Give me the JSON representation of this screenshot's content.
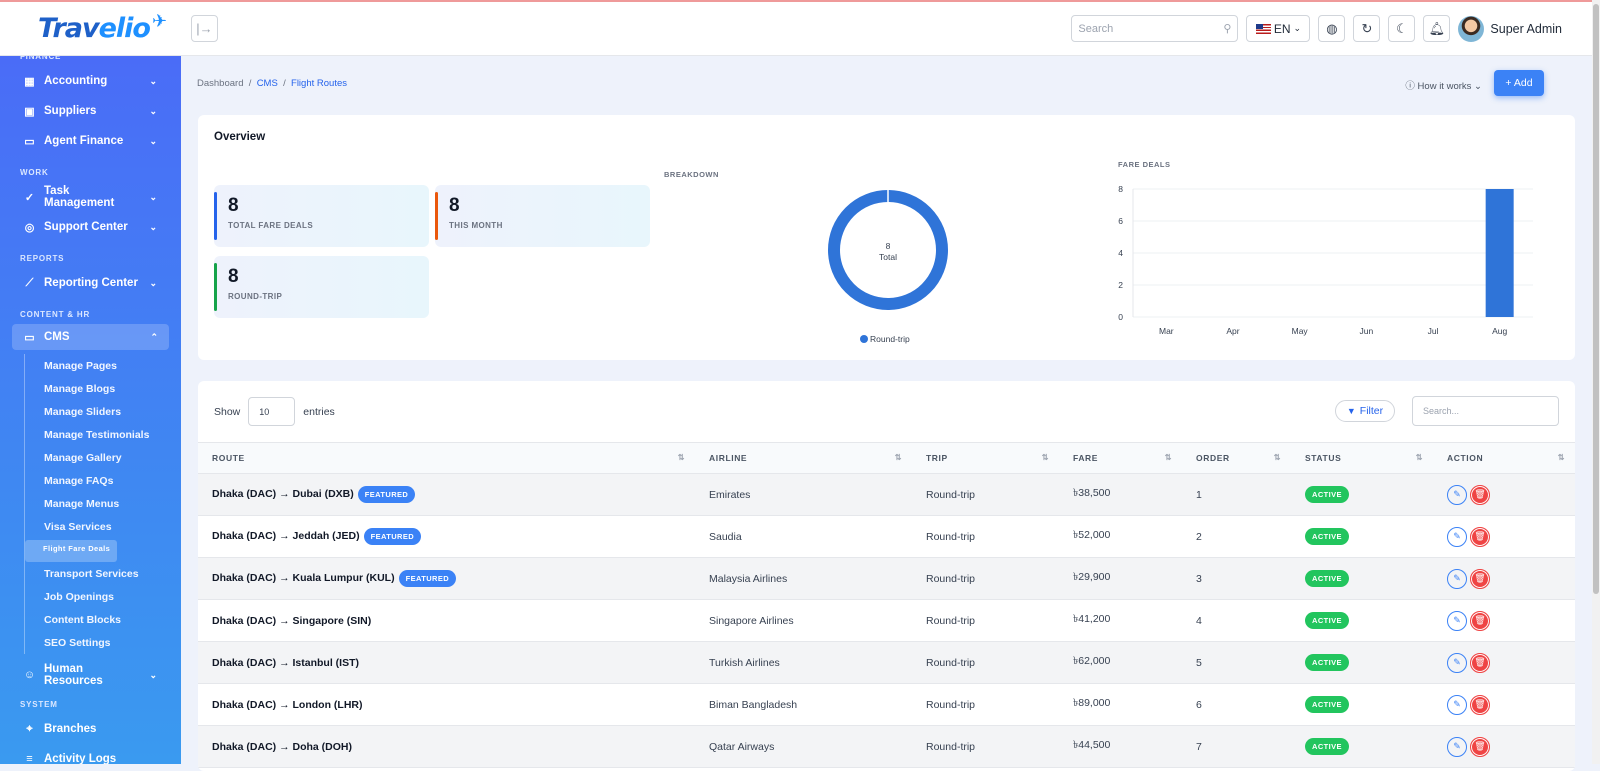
{
  "brand": {
    "part1": "Trav",
    "part2": "elio"
  },
  "header": {
    "search_placeholder": "Search",
    "language": "EN",
    "user_name": "Super Admin"
  },
  "sidebar": {
    "top_section": "FINANCE",
    "finance": [
      "Accounting",
      "Suppliers",
      "Agent Finance"
    ],
    "work_section": "WORK",
    "work": [
      "Task Management",
      "Support Center"
    ],
    "reports_section": "REPORTS",
    "reports": [
      "Reporting Center"
    ],
    "content_section": "CONTENT & HR",
    "cms_label": "CMS",
    "cms_items": [
      "Manage Pages",
      "Manage Blogs",
      "Manage Sliders",
      "Manage Testimonials",
      "Manage Gallery",
      "Manage FAQs",
      "Manage Menus",
      "Visa Services",
      "Flight Fare Deals",
      "Transport Services",
      "Job Openings",
      "Content Blocks",
      "SEO Settings"
    ],
    "active_item": "Flight Fare Deals",
    "hr_label": "Human Resources",
    "system_section": "SYSTEM",
    "branches_label": "Branches",
    "cut_label": "Activity Logs"
  },
  "breadcrumb": {
    "home": "Dashboard",
    "section": "CMS",
    "current": "Flight Routes"
  },
  "actions": {
    "how_it_works": "How it works",
    "add": "+ Add"
  },
  "overview": {
    "title": "Overview",
    "stats": [
      {
        "value": "8",
        "label": "TOTAL FARE DEALS",
        "color": "#2563eb"
      },
      {
        "value": "8",
        "label": "THIS MONTH",
        "color": "#ea580c"
      },
      {
        "value": "8",
        "label": "ROUND-TRIP",
        "color": "#16a34a"
      }
    ],
    "breakdown_caption": "BREAKDOWN",
    "fare_deals_caption": "FARE DEALS"
  },
  "chart_data": [
    {
      "type": "pie",
      "title": "BREAKDOWN",
      "categories": [
        "Round-trip"
      ],
      "values": [
        8
      ],
      "center_value": "8",
      "center_label": "Total",
      "legend_position": "bottom",
      "colors": [
        "#2f74d8"
      ]
    },
    {
      "type": "bar",
      "title": "FARE DEALS",
      "categories": [
        "Mar",
        "Apr",
        "May",
        "Jun",
        "Jul",
        "Aug"
      ],
      "values": [
        0,
        0,
        0,
        0,
        0,
        8
      ],
      "ylim": [
        0,
        8
      ],
      "yticks": [
        0,
        2,
        4,
        6,
        8
      ],
      "grid": true,
      "colors": [
        "#2f74d8"
      ]
    }
  ],
  "table": {
    "show_label": "Show",
    "entries_value": "10",
    "entries_label": "entries",
    "filter_label": "Filter",
    "search_placeholder": "Search...",
    "columns": [
      "ROUTE",
      "AIRLINE",
      "TRIP",
      "FARE",
      "ORDER",
      "STATUS",
      "ACTION"
    ],
    "rows": [
      {
        "route": "Dhaka (DAC) → Dubai (DXB)",
        "featured": "FEATURED",
        "airline": "Emirates",
        "trip": "Round-trip",
        "fare": "৳38,500",
        "order": "1",
        "status": "ACTIVE"
      },
      {
        "route": "Dhaka (DAC) → Jeddah (JED)",
        "featured": "FEATURED",
        "airline": "Saudia",
        "trip": "Round-trip",
        "fare": "৳52,000",
        "order": "2",
        "status": "ACTIVE"
      },
      {
        "route": "Dhaka (DAC) → Kuala Lumpur (KUL)",
        "featured": "FEATURED",
        "airline": "Malaysia Airlines",
        "trip": "Round-trip",
        "fare": "৳29,900",
        "order": "3",
        "status": "ACTIVE"
      },
      {
        "route": "Dhaka (DAC) → Singapore (SIN)",
        "featured": "",
        "airline": "Singapore Airlines",
        "trip": "Round-trip",
        "fare": "৳41,200",
        "order": "4",
        "status": "ACTIVE"
      },
      {
        "route": "Dhaka (DAC) → Istanbul (IST)",
        "featured": "",
        "airline": "Turkish Airlines",
        "trip": "Round-trip",
        "fare": "৳62,000",
        "order": "5",
        "status": "ACTIVE"
      },
      {
        "route": "Dhaka (DAC) → London (LHR)",
        "featured": "",
        "airline": "Biman Bangladesh",
        "trip": "Round-trip",
        "fare": "৳89,000",
        "order": "6",
        "status": "ACTIVE"
      },
      {
        "route": "Dhaka (DAC) → Doha (DOH)",
        "featured": "",
        "airline": "Qatar Airways",
        "trip": "Round-trip",
        "fare": "৳44,500",
        "order": "7",
        "status": "ACTIVE"
      }
    ]
  }
}
